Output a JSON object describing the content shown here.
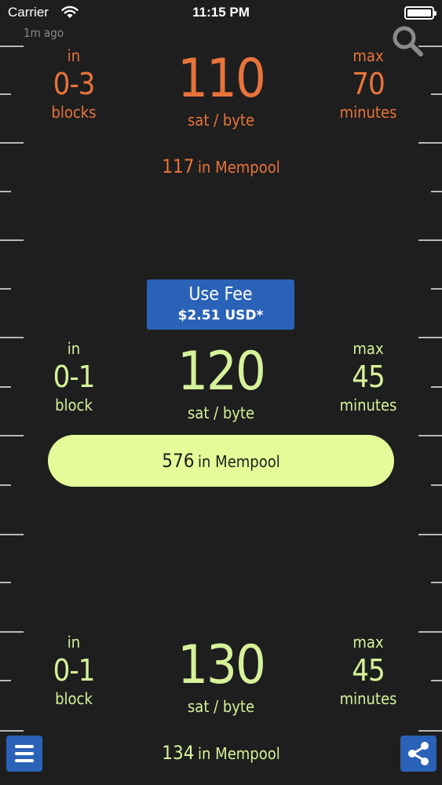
{
  "status_bar": {
    "carrier": "Carrier",
    "time": "11:15 PM"
  },
  "header": {
    "updated": "1m ago",
    "search_icon": "search-icon"
  },
  "colors": {
    "background": "#1e1e1e",
    "orange": "#e8743b",
    "green": "#d6f29a",
    "pill": "#e5fb99",
    "accent_blue": "#2a62b8"
  },
  "tiers": [
    {
      "in_label": "in",
      "blocks": "0-3",
      "blocks_unit": "blocks",
      "fee": "110",
      "fee_unit": "sat / byte",
      "max_label": "max",
      "minutes": "70",
      "minutes_unit": "minutes",
      "mempool_count": "117",
      "mempool_label": "in Mempool"
    },
    {
      "in_label": "in",
      "blocks": "0-1",
      "blocks_unit": "block",
      "fee": "120",
      "fee_unit": "sat / byte",
      "max_label": "max",
      "minutes": "45",
      "minutes_unit": "minutes",
      "mempool_count": "576",
      "mempool_label": "in Mempool"
    },
    {
      "in_label": "in",
      "blocks": "0-1",
      "blocks_unit": "block",
      "fee": "130",
      "fee_unit": "sat / byte",
      "max_label": "max",
      "minutes": "45",
      "minutes_unit": "minutes",
      "mempool_count": "134",
      "mempool_label": "in Mempool"
    }
  ],
  "use_fee": {
    "label": "Use Fee",
    "amount": "$2.51 USD*"
  },
  "footer": {
    "menu_icon": "menu-icon",
    "share_icon": "share-icon"
  }
}
